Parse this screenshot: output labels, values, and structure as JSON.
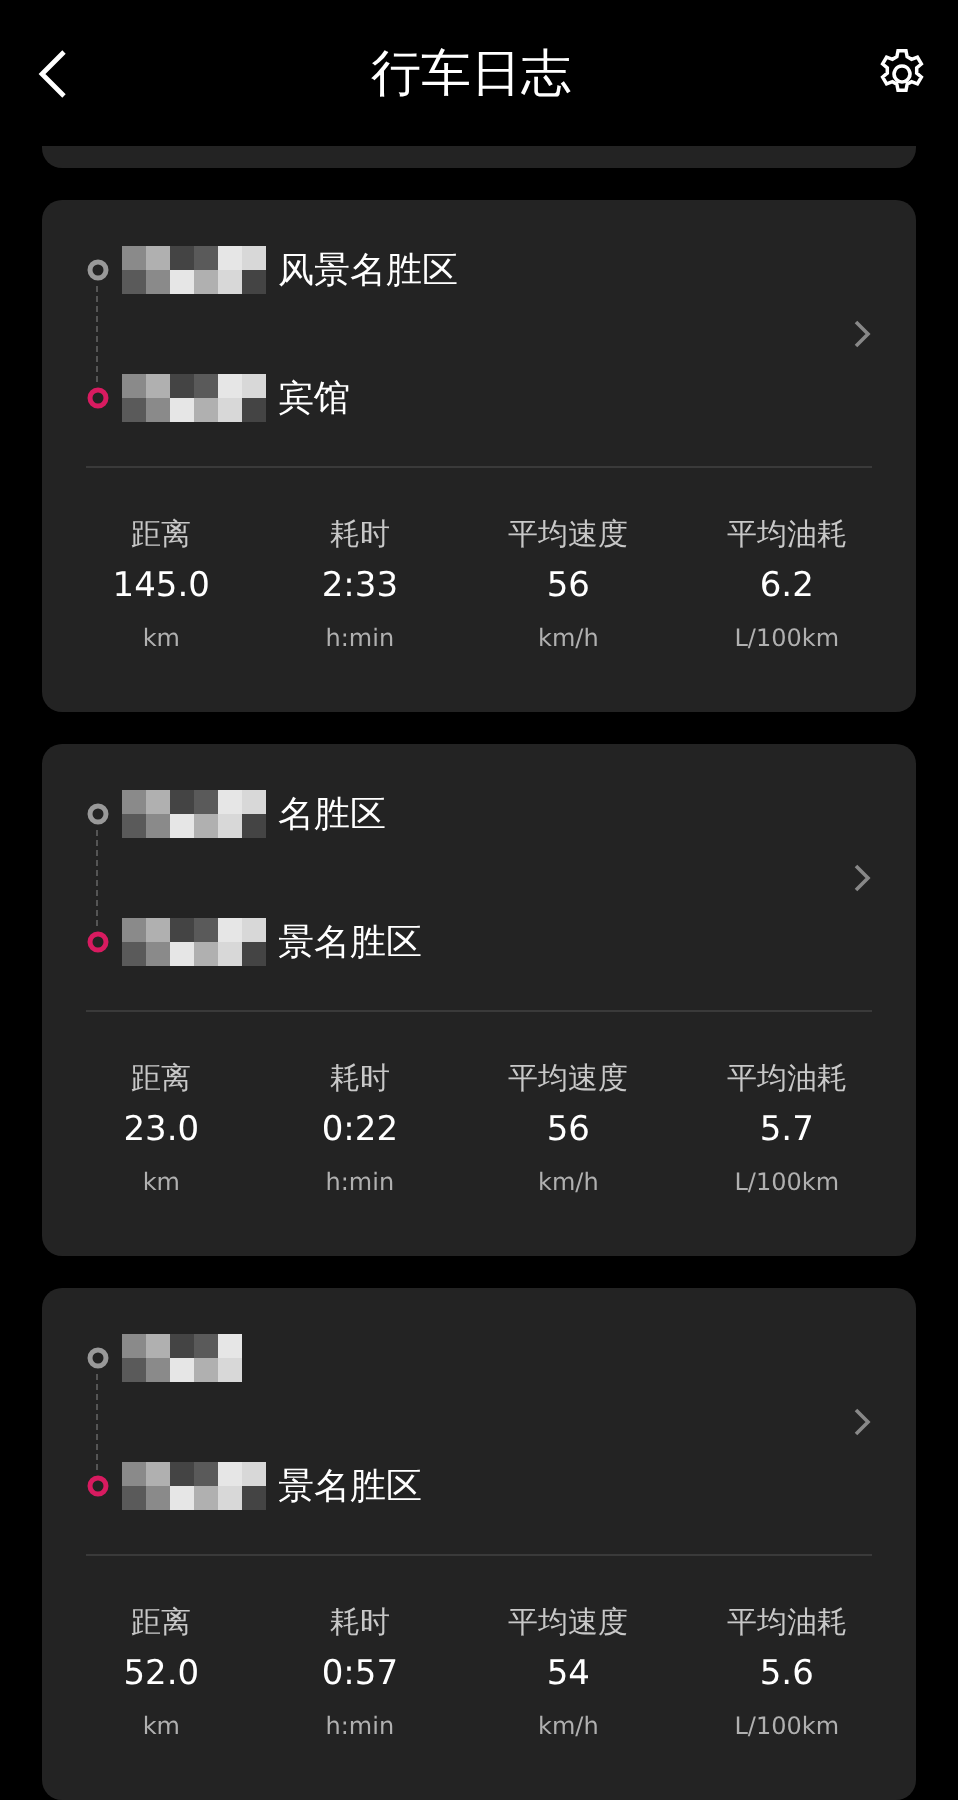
{
  "header": {
    "title": "行车日志"
  },
  "trips": [
    {
      "start": "风景名胜区",
      "end": "宾馆",
      "stats": [
        {
          "label": "距离",
          "value": "145.0",
          "unit": "km"
        },
        {
          "label": "耗时",
          "value": "2:33",
          "unit": "h:min"
        },
        {
          "label": "平均速度",
          "value": "56",
          "unit": "km/h"
        },
        {
          "label": "平均油耗",
          "value": "6.2",
          "unit": "L/100km"
        }
      ]
    },
    {
      "start": "名胜区",
      "end": "景名胜区",
      "stats": [
        {
          "label": "距离",
          "value": "23.0",
          "unit": "km"
        },
        {
          "label": "耗时",
          "value": "0:22",
          "unit": "h:min"
        },
        {
          "label": "平均速度",
          "value": "56",
          "unit": "km/h"
        },
        {
          "label": "平均油耗",
          "value": "5.7",
          "unit": "L/100km"
        }
      ]
    },
    {
      "end": "景名胜区",
      "stats": [
        {
          "label": "距离",
          "value": "52.0",
          "unit": "km"
        },
        {
          "label": "耗时",
          "value": "0:57",
          "unit": "h:min"
        },
        {
          "label": "平均速度",
          "value": "54",
          "unit": "km/h"
        },
        {
          "label": "平均油耗",
          "value": "5.6",
          "unit": "L/100km"
        }
      ]
    }
  ]
}
